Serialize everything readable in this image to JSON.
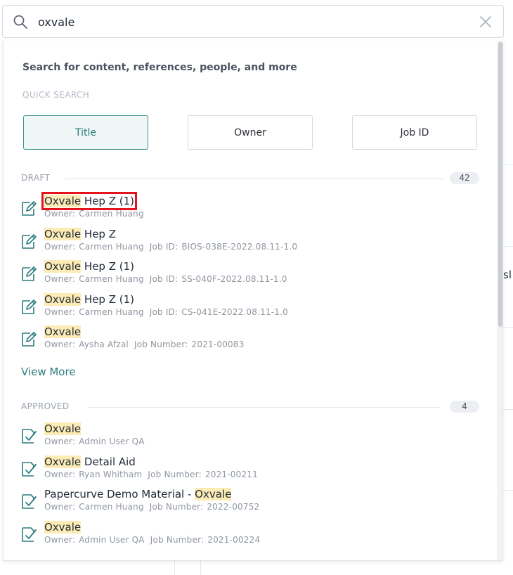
{
  "search": {
    "value": "oxvale",
    "placeholder": ""
  },
  "panel": {
    "hint": "Search for content, references, people, and more",
    "quick_search_label": "QUICK SEARCH",
    "quick_search_buttons": [
      {
        "label": "Title",
        "active": true
      },
      {
        "label": "Owner",
        "active": false
      },
      {
        "label": "Job ID",
        "active": false
      }
    ]
  },
  "background": {
    "partial_text": "sl"
  },
  "draft": {
    "title": "DRAFT",
    "count": "42",
    "items": [
      {
        "title_hl": "Oxvale",
        "title_rest": " Hep Z (1)",
        "owner_label": "Owner:",
        "owner": "Carmen Huang",
        "ref_label": "",
        "ref": ""
      },
      {
        "title_hl": "Oxvale",
        "title_rest": " Hep Z",
        "owner_label": "Owner:",
        "owner": "Carmen Huang",
        "ref_label": "Job ID:",
        "ref": "BIOS-038E-2022.08.11-1.0"
      },
      {
        "title_hl": "Oxvale",
        "title_rest": " Hep Z (1)",
        "owner_label": "Owner:",
        "owner": "Carmen Huang",
        "ref_label": "Job ID:",
        "ref": "SS-040F-2022.08.11-1.0"
      },
      {
        "title_hl": "Oxvale",
        "title_rest": " Hep Z (1)",
        "owner_label": "Owner:",
        "owner": "Carmen Huang",
        "ref_label": "Job ID:",
        "ref": "CS-041E-2022.08.11-1.0"
      },
      {
        "title_hl": "Oxvale",
        "title_rest": "",
        "owner_label": "Owner:",
        "owner": "Aysha Afzal",
        "ref_label": "Job Number:",
        "ref": "2021-00083"
      }
    ],
    "view_more": "View More"
  },
  "approved": {
    "title": "APPROVED",
    "count": "4",
    "items": [
      {
        "title_pre": "",
        "title_hl": "Oxvale",
        "title_rest": "",
        "owner_label": "Owner:",
        "owner": "Admin User QA",
        "ref_label": "",
        "ref": ""
      },
      {
        "title_pre": "",
        "title_hl": "Oxvale",
        "title_rest": " Detail Aid",
        "owner_label": "Owner:",
        "owner": "Ryan Whitham",
        "ref_label": "Job Number:",
        "ref": "2021-00211"
      },
      {
        "title_pre": "Papercurve Demo Material - ",
        "title_hl": "Oxvale",
        "title_rest": "",
        "owner_label": "Owner:",
        "owner": "Carmen Huang",
        "ref_label": "Job Number:",
        "ref": "2022-00752"
      },
      {
        "title_pre": "",
        "title_hl": "Oxvale",
        "title_rest": "",
        "owner_label": "Owner:",
        "owner": "Admin User QA",
        "ref_label": "Job Number:",
        "ref": "2021-00224"
      }
    ]
  },
  "colors": {
    "accent": "#2c7b7d",
    "highlight": "#fcebb4",
    "selection_outline": "#e3141b",
    "icon": "#2c7b7d"
  },
  "icons": {
    "search": "search-icon",
    "clear": "close-icon",
    "draft_item": "edit-document-icon",
    "approved_item": "approved-document-icon"
  }
}
